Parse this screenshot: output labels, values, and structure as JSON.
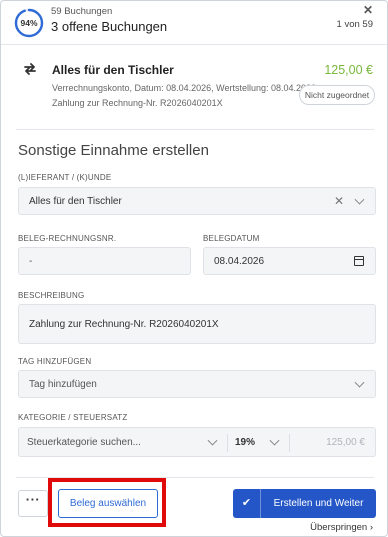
{
  "header": {
    "progress_percent": 94,
    "progress_label": "94%",
    "count_label": "59 Buchungen",
    "title": "3 offene Buchungen",
    "close_icon": "close-icon",
    "pager": "1 von 59"
  },
  "transaction": {
    "icon": "transfer-arrows-icon",
    "title": "Alles für den Tischler",
    "amount": "125,00 €",
    "amount_color": "#79b83a",
    "detail_line": "Verrechnungskonto, Datum: 08.04.2026, Wertstellung: 08.04.2026",
    "reference_line": "Zahlung zur Rechnung-Nr. R2026040201X",
    "status_badge": "Nicht zugeordnet"
  },
  "form": {
    "section_title": "Sonstige Einnahme erstellen",
    "supplier": {
      "label": "(L)IEFERANT / (K)UNDE",
      "value": "Alles für den Tischler"
    },
    "invoice_number": {
      "label": "BELEG-RECHNUNGSNR.",
      "value": "-"
    },
    "receipt_date": {
      "label": "BELEGDATUM",
      "value": "08.04.2026"
    },
    "description": {
      "label": "BESCHREIBUNG",
      "value": "Zahlung zur Rechnung-Nr. R2026040201X"
    },
    "tag": {
      "label": "TAG HINZUFÜGEN",
      "placeholder": "Tag hinzufügen"
    },
    "category": {
      "label": "KATEGORIE / STEUERSATZ",
      "placeholder": "Steuerkategorie suchen...",
      "tax_rate": "19%",
      "amount_placeholder": "125,00 €"
    }
  },
  "footer": {
    "more_label": "···",
    "select_receipt_label": "Beleg auswählen",
    "primary_label": "Erstellen und Weiter",
    "check_icon": "checkmark-icon",
    "skip_label": "Überspringen ›"
  },
  "colors": {
    "primary": "#2456c7",
    "highlight": "#e00a0a",
    "progress": "#2f6bd6"
  }
}
